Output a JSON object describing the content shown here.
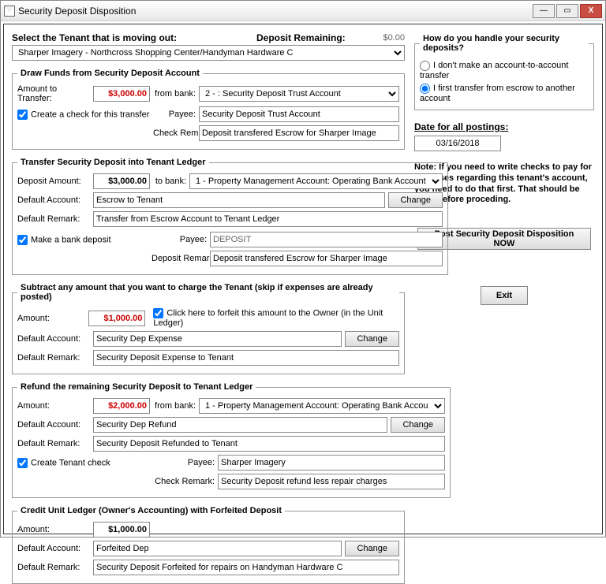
{
  "window": {
    "title": "Security Deposit Disposition"
  },
  "header": {
    "select_tenant_label": "Select the Tenant that is moving out:",
    "deposit_remaining_label": "Deposit Remaining:",
    "deposit_remaining_value": "$0.00",
    "tenant_value": "Sharper Imagery - Northcross Shopping Center/Handyman Hardware C"
  },
  "draw": {
    "legend": "Draw Funds from Security Deposit Account",
    "amount_label": "Amount to Transfer:",
    "amount": "$3,000.00",
    "from_bank_label": "from bank:",
    "from_bank_value": "2 - : Security Deposit Trust Account",
    "create_check_label": "Create a check for this transfer",
    "payee_label": "Payee:",
    "payee": "Security Deposit Trust Account",
    "remark_label": "Check Remark:",
    "remark": "Deposit transfered Escrow for Sharper Image"
  },
  "transfer": {
    "legend": "Transfer Security Deposit into Tenant Ledger",
    "deposit_amount_label": "Deposit Amount:",
    "deposit_amount": "$3,000.00",
    "to_bank_label": "to bank:",
    "to_bank_value": "1 - Property Management Account: Operating Bank Account",
    "default_account_label": "Default Account:",
    "default_account": "Escrow to Tenant",
    "change_label": "Change",
    "default_remark_label": "Default Remark:",
    "default_remark": "Transfer from Escrow Account to Tenant Ledger",
    "make_deposit_label": "Make a bank deposit",
    "payee_label": "Payee:",
    "payee": "DEPOSIT",
    "deposit_remark_label": "Deposit Remark:",
    "deposit_remark": "Deposit transfered Escrow for Sharper Image"
  },
  "subtract": {
    "legend": "Subtract any amount that you want to charge the Tenant (skip if expenses are already posted)",
    "amount_label": "Amount:",
    "amount": "$1,000.00",
    "forfeit_label": "Click here to forfeit this amount to the Owner (in the Unit Ledger)",
    "default_account_label": "Default Account:",
    "default_account": "Security Dep Expense",
    "change_label": "Change",
    "default_remark_label": "Default Remark:",
    "default_remark": "Security Deposit Expense to Tenant"
  },
  "refund": {
    "legend": "Refund the remaining Security Deposit to Tenant Ledger",
    "amount_label": "Amount:",
    "amount": "$2,000.00",
    "from_bank_label": "from bank:",
    "from_bank_value": "1 - Property Management Account: Operating Bank Accou",
    "default_account_label": "Default Account:",
    "default_account": "Security Dep Refund",
    "change_label": "Change",
    "default_remark_label": "Default Remark:",
    "default_remark": "Security Deposit Refunded to Tenant",
    "create_check_label": "Create Tenant check",
    "payee_label": "Payee:",
    "payee": "Sharper Imagery",
    "remark_label": "Check Remark:",
    "remark": "Security Deposit refund less repair charges"
  },
  "credit": {
    "legend": "Credit Unit Ledger (Owner's Accounting) with Forfeited Deposit",
    "amount_label": "Amount:",
    "amount": "$1,000.00",
    "default_account_label": "Default Account:",
    "default_account": "Forfeited Dep",
    "change_label": "Change",
    "default_remark_label": "Default Remark:",
    "default_remark": "Security Deposit Forfeited for repairs on Handyman Hardware C"
  },
  "right": {
    "handle_label": "How do you handle your security deposits?",
    "opt1": "I don't make an account-to-account transfer",
    "opt2": "I first transfer from escrow to another account",
    "date_label": "Date for all postings:",
    "date_value": "03/16/2018",
    "note": "Note: If you need to write checks to pay for expenses regarding this tenant's account, you need to do that first. That should be done before proceding.",
    "post_btn": "Post Security Deposit Disposition NOW",
    "exit_btn": "Exit"
  }
}
